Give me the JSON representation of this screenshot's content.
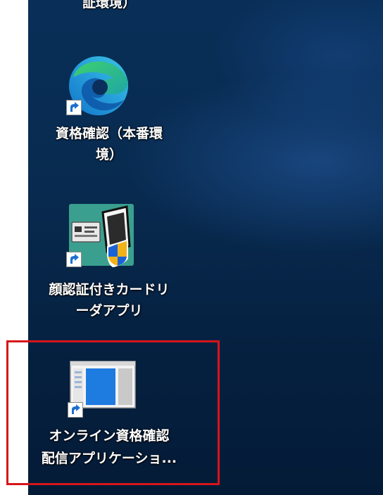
{
  "desktop": {
    "icons": [
      {
        "id": "edge-partial",
        "name_line1": "証環境）",
        "name_line2": "",
        "icon": "edge-icon"
      },
      {
        "id": "edge-production",
        "name_line1": "資格確認（本番環",
        "name_line2": "境）",
        "icon": "edge-icon"
      },
      {
        "id": "card-reader",
        "name_line1": "顔認証付きカードリ",
        "name_line2": "ーダアプリ",
        "icon": "card-reader-app-icon"
      },
      {
        "id": "online-qualification",
        "name_line1": "オンライン資格確認",
        "name_line2": "配信アプリケーショ...",
        "icon": "application-window-icon",
        "highlighted": true
      }
    ]
  },
  "colors": {
    "desktop_background": "#082a4f",
    "highlight_frame": "#d7141a",
    "label_text": "#ffffff"
  }
}
